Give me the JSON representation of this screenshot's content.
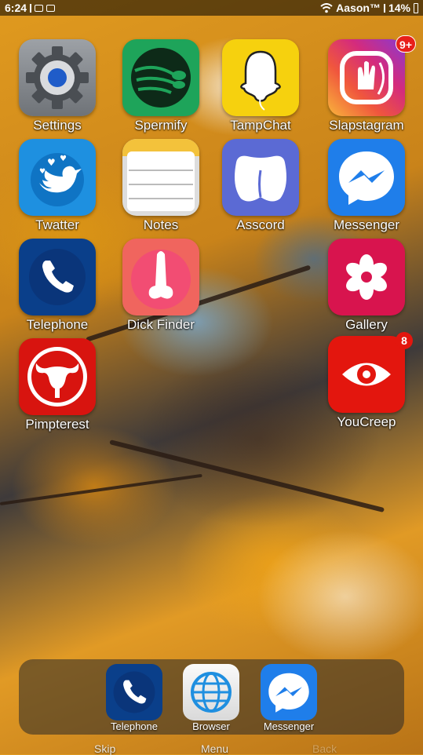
{
  "status_bar": {
    "time": "6:24",
    "carrier": "Aason™",
    "battery": "14%"
  },
  "apps": [
    {
      "label": "Settings",
      "icon": "gear-icon"
    },
    {
      "label": "Spermify",
      "icon": "sperm-icon"
    },
    {
      "label": "TampChat",
      "icon": "tampon-ghost-icon"
    },
    {
      "label": "Slapstagram",
      "icon": "hand-icon",
      "badge": "9+"
    },
    {
      "label": "Twatter",
      "icon": "bird-icon"
    },
    {
      "label": "Notes",
      "icon": "notepad-icon"
    },
    {
      "label": "Asscord",
      "icon": "butt-icon"
    },
    {
      "label": "Messenger",
      "icon": "lightning-bubble-icon"
    },
    {
      "label": "Telephone",
      "icon": "phone-icon"
    },
    {
      "label": "Dick Finder",
      "icon": "phallus-icon"
    },
    {
      "label": "Gallery",
      "icon": "flower-icon"
    },
    {
      "label": "Pimpterest",
      "icon": "uterus-icon"
    },
    {
      "label": "YouCreep",
      "icon": "eye-icon",
      "badge": "8"
    }
  ],
  "dock": [
    {
      "label": "Telephone",
      "icon": "phone-icon"
    },
    {
      "label": "Browser",
      "icon": "globe-icon"
    },
    {
      "label": "Messenger",
      "icon": "lightning-bubble-icon"
    }
  ],
  "nav": {
    "skip": "Skip",
    "menu": "Menu",
    "back": "Back"
  },
  "colors": {
    "settings": "#8a8e93",
    "spermify": "#1ea45a",
    "tampchat": "#f6d10e",
    "twatter": "#1e90e0",
    "telephone": "#0a3f8a",
    "dickfinder": "#f0655e",
    "gallery": "#d8144e",
    "pimpterest": "#d8140f",
    "youcreep": "#e3160e"
  }
}
